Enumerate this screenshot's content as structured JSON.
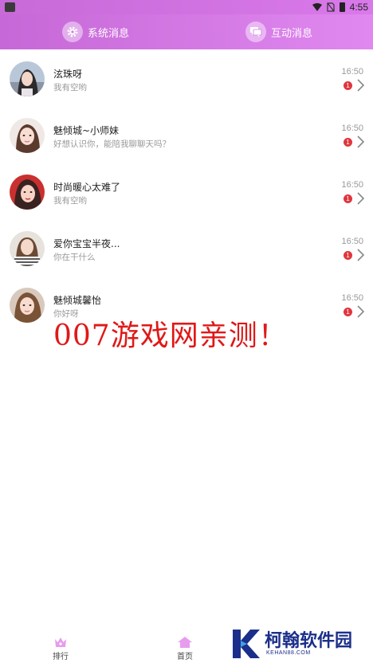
{
  "status_bar": {
    "time": "4:55"
  },
  "tabs": {
    "system_label": "系统消息",
    "interact_label": "互动消息"
  },
  "messages": [
    {
      "name": "泫珠呀",
      "preview": "我有空哟",
      "time": "16:50",
      "badge": "1"
    },
    {
      "name": "魅倾城~小师妹",
      "preview": "好想认识你，能陪我聊聊天吗？",
      "time": "16:50",
      "badge": "1"
    },
    {
      "name": "时尚暖心太难了",
      "preview": "我有空哟",
      "time": "16:50",
      "badge": "1"
    },
    {
      "name": "爱你宝宝半夜...",
      "preview": "你在干什么",
      "time": "16:50",
      "badge": "1"
    },
    {
      "name": "魅倾城馨怡",
      "preview": "你好呀",
      "time": "16:50",
      "badge": "1"
    }
  ],
  "overlay_watermark": "007游戏网亲测！",
  "bottom_nav": {
    "rank_label": "排行",
    "home_label": "首页"
  },
  "brand_watermark": {
    "main": "柯翰软件园",
    "sub": "KEHAN88.COM"
  },
  "colors": {
    "header_gradient_start": "#c668d7",
    "header_gradient_end": "#e088f0",
    "badge_red": "#e0363e",
    "watermark_red": "#e01818",
    "brand_blue": "#1b2f8a"
  }
}
